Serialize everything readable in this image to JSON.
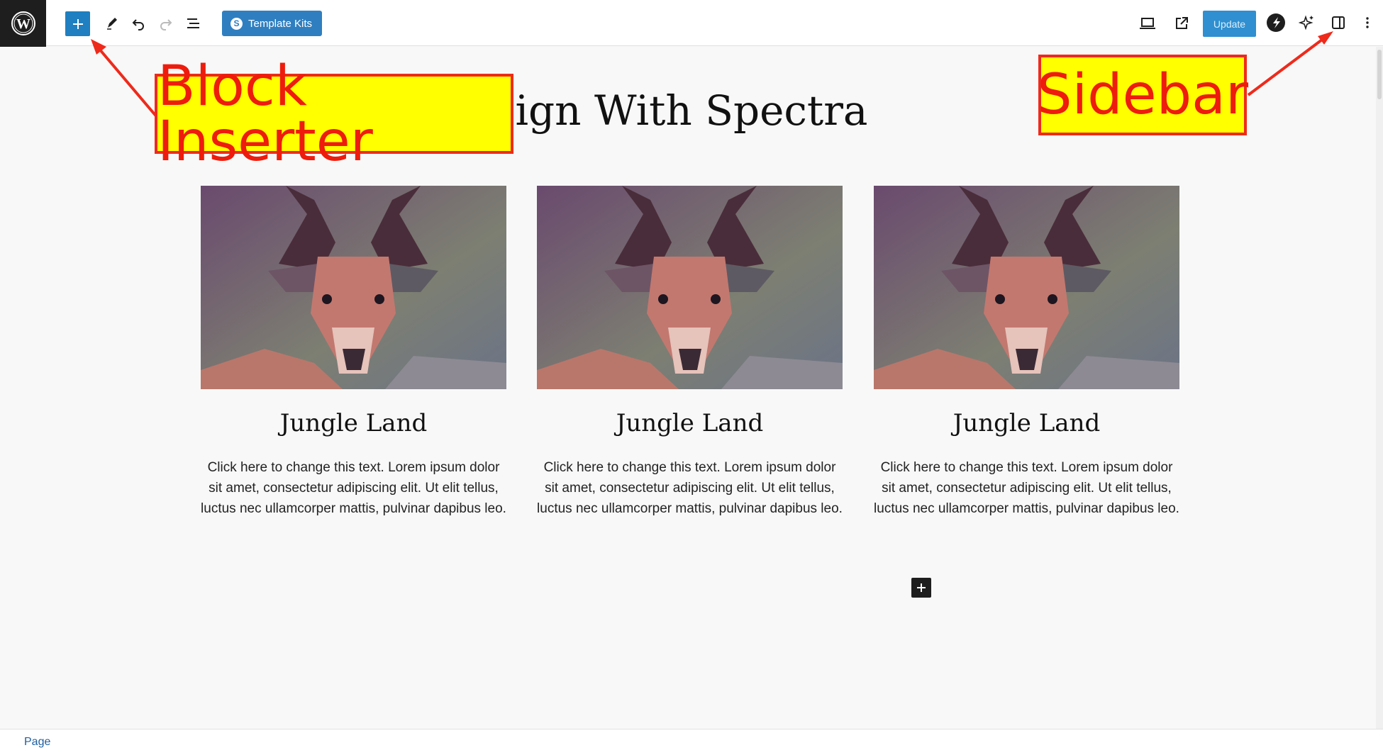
{
  "toolbar": {
    "template_kits_label": "Template Kits",
    "update_label": "Update"
  },
  "page": {
    "title": "ign With Spectra"
  },
  "cards": [
    {
      "title": "Jungle Land",
      "text": "Click here to change this text. Lorem ipsum dolor sit amet, consectetur adipiscing elit. Ut elit tellus, luctus nec ullamcorper mattis, pulvinar dapibus leo."
    },
    {
      "title": "Jungle Land",
      "text": "Click here to change this text. Lorem ipsum dolor sit amet, consectetur adipiscing elit. Ut elit tellus, luctus nec ullamcorper mattis, pulvinar dapibus leo."
    },
    {
      "title": "Jungle Land",
      "text": "Click here to change this text. Lorem ipsum dolor sit amet, consectetur adipiscing elit. Ut elit tellus, luctus nec ullamcorper mattis, pulvinar dapibus leo."
    }
  ],
  "annotations": {
    "block_inserter": "Block Inserter",
    "sidebar": "Sidebar"
  },
  "footer": {
    "breadcrumb": "Page"
  },
  "icons": {
    "logo": "wordpress-logo-icon",
    "inserter": "plus-icon",
    "tools": "pencil-icon",
    "undo": "undo-icon",
    "redo": "redo-icon",
    "list_view": "list-view-icon",
    "spectra": "spectra-icon",
    "view": "laptop-preview-icon",
    "view_post": "external-link-icon",
    "ai": "sparkles-icon",
    "settings": "sidebar-toggle-icon",
    "more": "more-vertical-icon",
    "add_block": "plus-icon"
  },
  "colors": {
    "primary": "#1f7fc0",
    "annotation_fill": "#ffff00",
    "annotation_stroke": "#ee2a1b"
  }
}
